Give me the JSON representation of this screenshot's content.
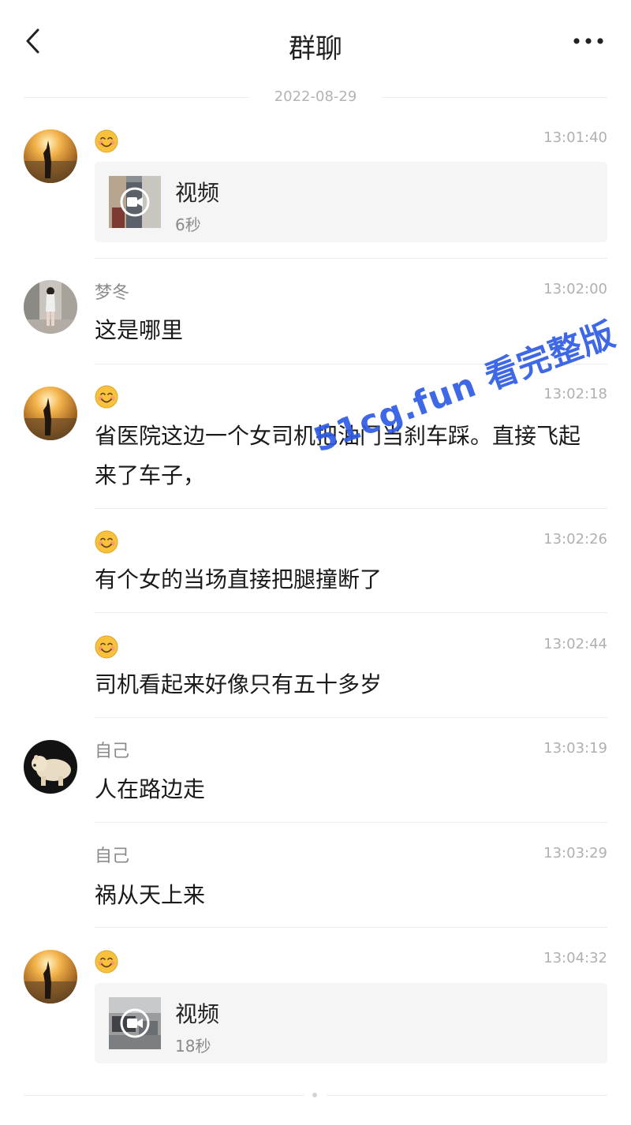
{
  "header": {
    "title": "群聊",
    "back_icon": "chevron-left-icon",
    "more_icon": "more-dots-icon"
  },
  "date_separator": "2022-08-29",
  "messages": [
    {
      "sender": "",
      "avatar": "sunset-silhouette",
      "time": "13:01:40",
      "type": "video",
      "video_label": "视频",
      "video_duration": "6秒"
    },
    {
      "sender": "梦冬",
      "avatar": "girl-street",
      "time": "13:02:00",
      "type": "text",
      "text": "这是哪里"
    },
    {
      "sender": "",
      "avatar": "sunset-silhouette",
      "time": "13:02:18",
      "type": "text",
      "text": "省医院这边一个女司机把油门当刹车踩。直接飞起来了车子，"
    },
    {
      "sender": "",
      "avatar": "",
      "time": "13:02:26",
      "type": "text",
      "text": "有个女的当场直接把腿撞断了"
    },
    {
      "sender": "",
      "avatar": "",
      "time": "13:02:44",
      "type": "text",
      "text": "司机看起来好像只有五十多岁"
    },
    {
      "sender": "自己",
      "avatar": "polar-bear",
      "time": "13:03:19",
      "type": "text",
      "text": "人在路边走"
    },
    {
      "sender": "自己",
      "avatar": "",
      "time": "13:03:29",
      "type": "text",
      "text": "祸从天上来"
    },
    {
      "sender": "",
      "avatar": "sunset-silhouette",
      "time": "13:04:32",
      "type": "video",
      "video_label": "视频",
      "video_duration": "18秒"
    }
  ],
  "watermark": "51cg.fun 看完整版",
  "colors": {
    "watermark": "#2f5ce6",
    "card_bg": "#f5f5f5",
    "time": "#b0b0b0"
  }
}
